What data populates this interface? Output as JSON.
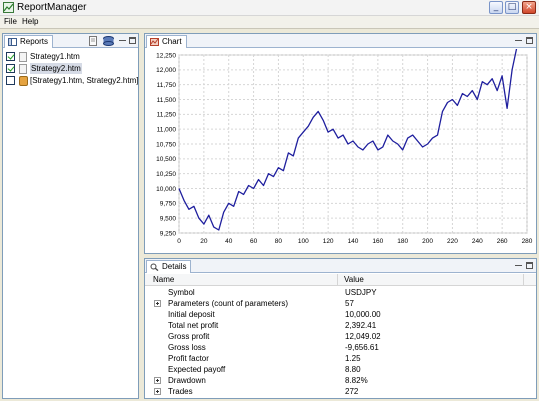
{
  "window": {
    "title": "ReportManager"
  },
  "menu": {
    "items": [
      "File",
      "Help"
    ]
  },
  "reports_view": {
    "tab_label": "Reports",
    "items": [
      {
        "label": "Strategy1.htm",
        "checked": true,
        "icon": "file-icon"
      },
      {
        "label": "Strategy2.htm",
        "checked": true,
        "icon": "file-icon",
        "selected": true
      },
      {
        "label": "[Strategy1.htm, Strategy2.htm]",
        "checked": false,
        "icon": "database-icon"
      }
    ]
  },
  "chart_view": {
    "tab_label": "Chart"
  },
  "chart_data": {
    "type": "line",
    "title": "",
    "xlabel": "",
    "ylabel": "",
    "xlim": [
      0,
      280
    ],
    "ylim": [
      9250,
      12250
    ],
    "x_ticks": [
      0,
      20,
      40,
      60,
      80,
      100,
      120,
      140,
      160,
      180,
      200,
      220,
      240,
      260,
      280
    ],
    "y_ticks": [
      9250,
      9500,
      9750,
      10000,
      10250,
      10500,
      10750,
      11000,
      11250,
      11500,
      11750,
      12000,
      12250
    ],
    "y_tick_labels": [
      "9,250",
      "9,500",
      "9,750",
      "10,000",
      "10,250",
      "10,500",
      "10,750",
      "11,000",
      "11,250",
      "11,500",
      "11,750",
      "12,000",
      "12,250"
    ],
    "grid": true,
    "line_color": "#1f1f9e",
    "series": [
      {
        "x": [
          0,
          4,
          8,
          12,
          16,
          20,
          24,
          28,
          32,
          36,
          40,
          44,
          48,
          52,
          56,
          60,
          64,
          68,
          72,
          76,
          80,
          84,
          88,
          92,
          96,
          100,
          104,
          108,
          112,
          116,
          120,
          124,
          128,
          132,
          136,
          140,
          144,
          148,
          152,
          156,
          160,
          164,
          168,
          172,
          176,
          180,
          184,
          188,
          192,
          196,
          200,
          204,
          208,
          212,
          216,
          220,
          224,
          228,
          232,
          236,
          240,
          244,
          248,
          252,
          256,
          260,
          264,
          268,
          272
        ],
        "values": [
          10000,
          9800,
          9650,
          9700,
          9500,
          9400,
          9550,
          9350,
          9300,
          9600,
          9750,
          9700,
          9950,
          9900,
          10050,
          10000,
          10150,
          10050,
          10250,
          10200,
          10350,
          10300,
          10600,
          10550,
          10850,
          10950,
          11050,
          11200,
          11300,
          11150,
          10950,
          11000,
          10850,
          10900,
          10750,
          10800,
          10700,
          10650,
          10750,
          10800,
          10650,
          10700,
          10900,
          10800,
          10750,
          10650,
          10850,
          10900,
          10800,
          10700,
          10750,
          10850,
          10900,
          11300,
          11450,
          11500,
          11400,
          11600,
          11550,
          11650,
          11500,
          11800,
          11750,
          11850,
          11650,
          11900,
          11350,
          12000,
          12400
        ]
      }
    ]
  },
  "details_view": {
    "tab_label": "Details",
    "columns": {
      "name": "Name",
      "value": "Value"
    },
    "rows": [
      {
        "name": "Symbol",
        "value": "USDJPY",
        "expandable": false
      },
      {
        "name": "Parameters (count of parameters)",
        "value": "57",
        "expandable": true
      },
      {
        "name": "Initial deposit",
        "value": "10,000.00",
        "expandable": false
      },
      {
        "name": "Total net profit",
        "value": "2,392.41",
        "expandable": false
      },
      {
        "name": "Gross profit",
        "value": "12,049.02",
        "expandable": false
      },
      {
        "name": "Gross loss",
        "value": "-9,656.61",
        "expandable": false
      },
      {
        "name": "Profit factor",
        "value": "1.25",
        "expandable": false
      },
      {
        "name": "Expected payoff",
        "value": "8.80",
        "expandable": false
      },
      {
        "name": "Drawdown",
        "value": "8.82%",
        "expandable": true
      },
      {
        "name": "Trades",
        "value": "272",
        "expandable": true
      }
    ]
  }
}
